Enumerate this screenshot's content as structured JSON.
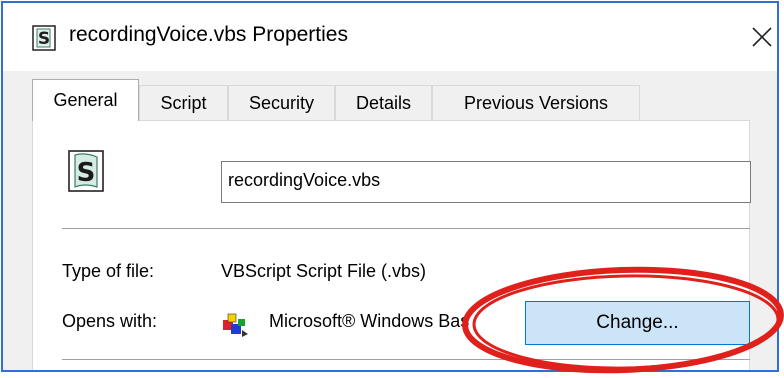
{
  "window": {
    "title": "recordingVoice.vbs Properties",
    "close_label": "×"
  },
  "tabs": [
    {
      "label": "General",
      "active": true
    },
    {
      "label": "Script",
      "active": false
    },
    {
      "label": "Security",
      "active": false
    },
    {
      "label": "Details",
      "active": false
    },
    {
      "label": "Previous Versions",
      "active": false
    }
  ],
  "general": {
    "file_name": "recordingVoice.vbs",
    "type_label": "Type of file:",
    "type_value": "VBScript Script File (.vbs)",
    "opens_label": "Opens with:",
    "opens_value": "Microsoft® Windows Bas",
    "change_label": "Change..."
  },
  "icons": {
    "title": "vbs-script-icon",
    "file": "vbs-script-icon",
    "opens_with": "windows-script-host-icon",
    "close": "close-icon"
  },
  "colors": {
    "frame_border": "#2f6fd6",
    "highlight_ellipse": "#e0201b",
    "change_button_bg": "#cce4f7",
    "change_button_border": "#0078d7"
  }
}
